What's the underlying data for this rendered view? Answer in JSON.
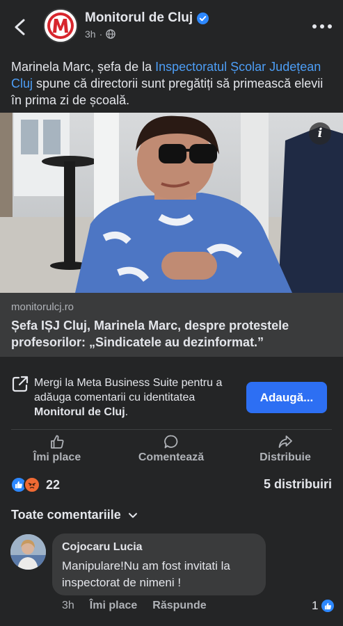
{
  "header": {
    "page_name": "Monitorul de Cluj",
    "time": "3h",
    "separator": "·"
  },
  "post": {
    "text_before": "Marinela Marc, șefa de la ",
    "text_link": "Inspectoratul Școlar Județean Cluj",
    "text_after": " spune că directorii sunt pregătiți să primească elevii în prima zi de școală."
  },
  "link_preview": {
    "domain": "monitorulcj.ro",
    "title": "Șefa IȘJ Cluj, Marinela Marc, despre protestele profesorilor: „Sindicatele au dezinformat.”"
  },
  "business_suite": {
    "text_before": "Mergi la Meta Business Suite pentru a adăuga comentarii cu identitatea ",
    "identity": "Monitorul de Cluj",
    "text_after": ".",
    "button_label": "Adaugă..."
  },
  "actions": {
    "like": "Îmi place",
    "comment": "Comentează",
    "share": "Distribuie"
  },
  "stats": {
    "reaction_count": "22",
    "shares": "5 distribuiri"
  },
  "comments": {
    "filter_label": "Toate comentariile",
    "items": [
      {
        "author": "Cojocaru Lucia",
        "text": "Manipulare!Nu am fost invitati la inspectorat de nimeni !",
        "time": "3h",
        "like_label": "Îmi place",
        "reply_label": "Răspunde",
        "reaction_count": "1"
      }
    ]
  },
  "colors": {
    "background": "#242526",
    "card": "#3a3b3c",
    "link": "#4d9ef6",
    "button": "#2d6ff3",
    "like": "#2d88ff",
    "angry": "#f06a34",
    "brand_red": "#d7262d"
  }
}
